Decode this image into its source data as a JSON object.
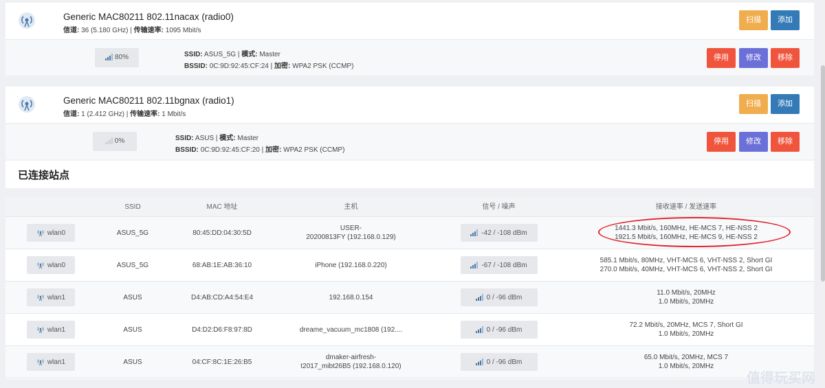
{
  "radios": [
    {
      "title": "Generic MAC80211 802.11nacax (radio0)",
      "channel_label": "信道:",
      "channel_value": "36 (5.180 GHz)",
      "sep": "|",
      "rate_label": "传输速率:",
      "rate_value": "1095 Mbit/s",
      "scan_label": "扫描",
      "add_label": "添加",
      "network": {
        "signal": "80%",
        "ssid_label": "SSID:",
        "ssid": "ASUS_5G",
        "mode_label": "模式:",
        "mode": "Master",
        "bssid_label": "BSSID:",
        "bssid": "0C:9D:92:45:CF:24",
        "enc_label": "加密:",
        "enc": "WPA2 PSK (CCMP)",
        "disable_label": "停用",
        "edit_label": "修改",
        "remove_label": "移除"
      }
    },
    {
      "title": "Generic MAC80211 802.11bgnax (radio1)",
      "channel_label": "信道:",
      "channel_value": "1 (2.412 GHz)",
      "sep": "|",
      "rate_label": "传输速率:",
      "rate_value": "1 Mbit/s",
      "scan_label": "扫描",
      "add_label": "添加",
      "network": {
        "signal": "0%",
        "ssid_label": "SSID:",
        "ssid": "ASUS",
        "mode_label": "模式:",
        "mode": "Master",
        "bssid_label": "BSSID:",
        "bssid": "0C:9D:92:45:CF:20",
        "enc_label": "加密:",
        "enc": "WPA2 PSK (CCMP)",
        "disable_label": "停用",
        "edit_label": "修改",
        "remove_label": "移除"
      }
    }
  ],
  "stations": {
    "title": "已连接站点",
    "headers": [
      "SSID",
      "MAC 地址",
      "主机",
      "信号 / 噪声",
      "接收速率 / 发送速率"
    ],
    "rows": [
      {
        "iface": "wlan0",
        "ssid": "ASUS_5G",
        "mac": "80:45:DD:04:30:5D",
        "host1": "USER-",
        "host2": "20200813FY (192.168.0.129)",
        "signal": "-42 / -108 dBm",
        "rx": "1441.3 Mbit/s, 160MHz, HE-MCS 7, HE-NSS 2",
        "tx": "1921.5 Mbit/s, 160MHz, HE-MCS 9, HE-NSS 2"
      },
      {
        "iface": "wlan0",
        "ssid": "ASUS_5G",
        "mac": "68:AB:1E:AB:36:10",
        "host1": "iPhone (192.168.0.220)",
        "host2": "",
        "signal": "-67 / -108 dBm",
        "rx": "585.1 Mbit/s, 80MHz, VHT-MCS 6, VHT-NSS 2, Short GI",
        "tx": "270.0 Mbit/s, 40MHz, VHT-MCS 6, VHT-NSS 2, Short GI"
      },
      {
        "iface": "wlan1",
        "ssid": "ASUS",
        "mac": "D4:AB:CD:A4:54:E4",
        "host1": "192.168.0.154",
        "host2": "",
        "signal": "0 / -96 dBm",
        "rx": "11.0 Mbit/s, 20MHz",
        "tx": "1.0 Mbit/s, 20MHz"
      },
      {
        "iface": "wlan1",
        "ssid": "ASUS",
        "mac": "D4:D2:D6:F8:97:8D",
        "host1": "dreame_vacuum_mc1808 (192....",
        "host2": "",
        "signal": "0 / -96 dBm",
        "rx": "72.2 Mbit/s, 20MHz, MCS 7, Short GI",
        "tx": "1.0 Mbit/s, 20MHz"
      },
      {
        "iface": "wlan1",
        "ssid": "ASUS",
        "mac": "04:CF:8C:1E:26:B5",
        "host1": "dmaker-airfresh-",
        "host2": "t2017_mibt26B5 (192.168.0.120)",
        "signal": "0 / -96 dBm",
        "rx": "65.0 Mbit/s, 20MHz, MCS 7",
        "tx": "1.0 Mbit/s, 20MHz"
      }
    ]
  },
  "watermark": "值得玩买网",
  "colors": {
    "scan": "#f0ad4e",
    "add": "#337ab7",
    "disable": "#f0543c",
    "edit": "#6b6fd8",
    "remove": "#f0543c",
    "highlight": "#e0262f"
  }
}
